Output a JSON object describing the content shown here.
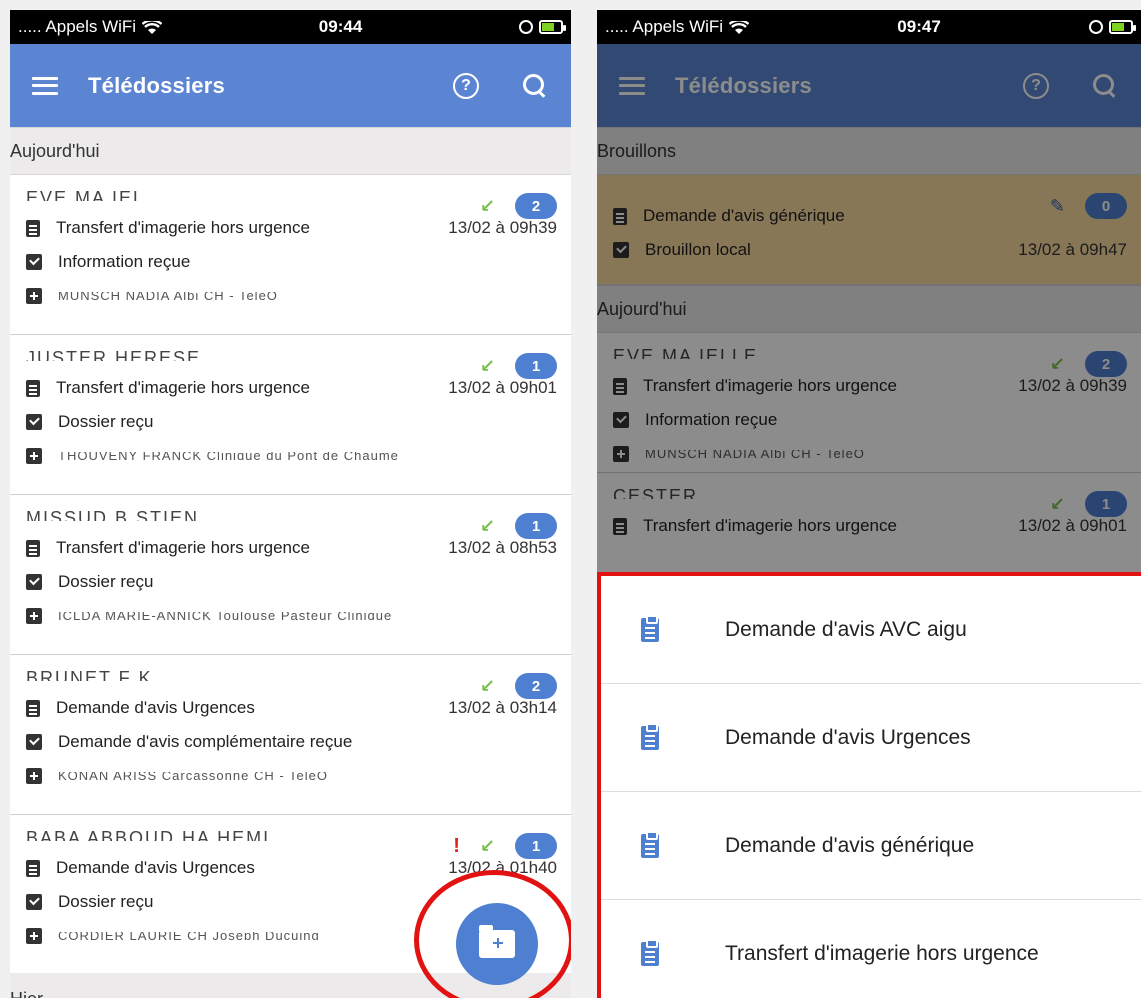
{
  "status_left": {
    "carrier": "..... Appels WiFi",
    "time": "09:44"
  },
  "status_right": {
    "carrier": "..... Appels WiFi",
    "time": "09:47"
  },
  "appbar": {
    "title": "Télédossiers",
    "help_glyph": "?"
  },
  "left": {
    "section_today": "Aujourd'hui",
    "section_yesterday": "Hier",
    "items": [
      {
        "name": "EVE MA  IEL",
        "type": "Transfert d'imagerie hors urgence",
        "date": "13/02 à 09h39",
        "status": "Information reçue",
        "sender": "MUNSCH NADIA Albi CH - TeleO",
        "badge": "2"
      },
      {
        "name": "JUSTER  HERESE",
        "type": "Transfert d'imagerie hors urgence",
        "date": "13/02 à 09h01",
        "status": "Dossier reçu",
        "sender": "THOUVENY FRANCK Clinique du Pont de Chaume",
        "badge": "1"
      },
      {
        "name": "MISSUD B  STIEN",
        "type": "Transfert d'imagerie hors urgence",
        "date": "13/02 à 08h53",
        "status": "Dossier reçu",
        "sender": "ICLDA MARIE-ANNICK Toulouse Pasteur Clinique",
        "badge": "1"
      },
      {
        "name": "BRUNET F  K",
        "type": "Demande d'avis Urgences",
        "date": "13/02 à 03h14",
        "status": "Demande d'avis complémentaire reçue",
        "sender": "KONAN ARISS Carcassonne CH - TeleO",
        "badge": "2"
      },
      {
        "name": "BABA ABBOUD HA  HEMI",
        "type": "Demande d'avis Urgences",
        "date": "13/02 à 01h40",
        "status": "Dossier reçu",
        "sender": "CORDIER LAURIE CH Joseph Ducuing",
        "badge": "1",
        "warning": "!"
      }
    ]
  },
  "right": {
    "section_drafts": "Brouillons",
    "section_today": "Aujourd'hui",
    "draft": {
      "type": "Demande d'avis générique",
      "status": "Brouillon local",
      "date": "13/02 à 09h47",
      "badge": "0"
    },
    "items": [
      {
        "name": "EVE MA  IELLE",
        "type": "Transfert d'imagerie hors urgence",
        "date": "13/02 à 09h39",
        "status": "Information reçue",
        "sender": "MUNSCH NADIA Albi CH - TeleO",
        "badge": "2"
      },
      {
        "name": "CESTER  ",
        "type": "Transfert d'imagerie hors urgence",
        "date": "13/02 à 09h01",
        "badge": "1"
      }
    ],
    "sheet": [
      "Demande d'avis AVC aigu",
      "Demande d'avis Urgences",
      "Demande d'avis générique",
      "Transfert d'imagerie hors urgence"
    ]
  },
  "colors": {
    "appbar": "#5b85d3",
    "badge": "#4e7fd0",
    "annotation": "#e21212",
    "draft": "#f7d99e"
  },
  "icons": [
    "menu-icon",
    "help-icon",
    "search-icon",
    "document-icon",
    "check-icon",
    "plus-icon",
    "arrow-icon",
    "folder-plus-icon",
    "clipboard-icon",
    "pencil-icon"
  ]
}
